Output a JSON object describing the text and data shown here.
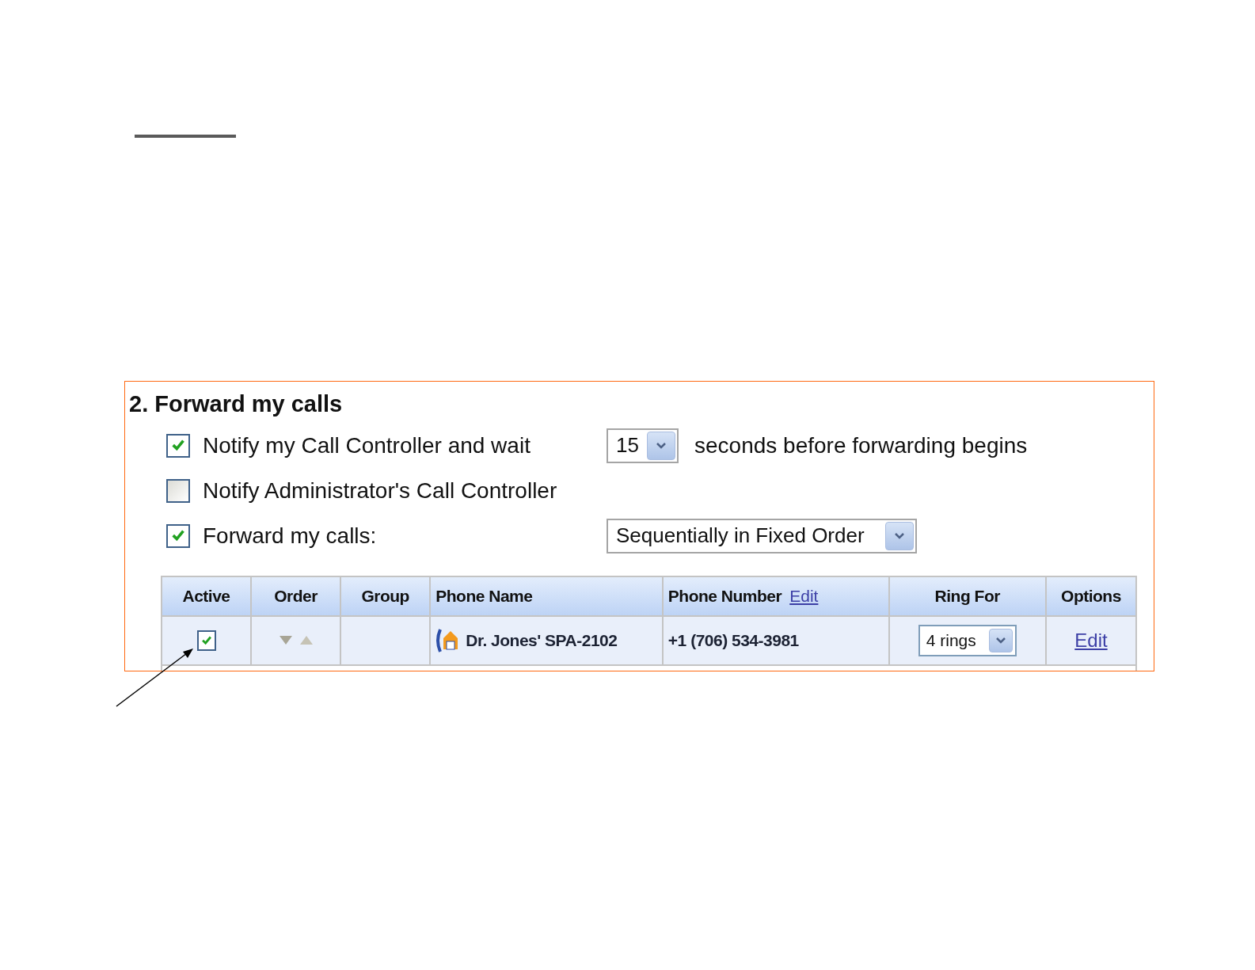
{
  "section": {
    "title": "2. Forward my calls",
    "options": [
      {
        "label": "Notify my Call Controller and wait",
        "checked": true,
        "select": {
          "value": "15"
        },
        "suffix": "seconds before forwarding begins"
      },
      {
        "label": "Notify Administrator's Call Controller",
        "checked": false
      },
      {
        "label": "Forward my calls:",
        "checked": true,
        "select": {
          "value": "Sequentially in Fixed Order"
        }
      }
    ]
  },
  "table": {
    "columns": [
      {
        "label": "Active"
      },
      {
        "label": "Order"
      },
      {
        "label": "Group"
      },
      {
        "label": "Phone Name"
      },
      {
        "label": "Phone Number",
        "link": "Edit"
      },
      {
        "label": "Ring For"
      },
      {
        "label": "Options"
      }
    ],
    "rows": [
      {
        "active": true,
        "phone_name": "Dr. Jones' SPA-2102",
        "phone_number": "+1 (706) 534-3981",
        "ring_for": "4 rings",
        "option": "Edit"
      }
    ]
  }
}
